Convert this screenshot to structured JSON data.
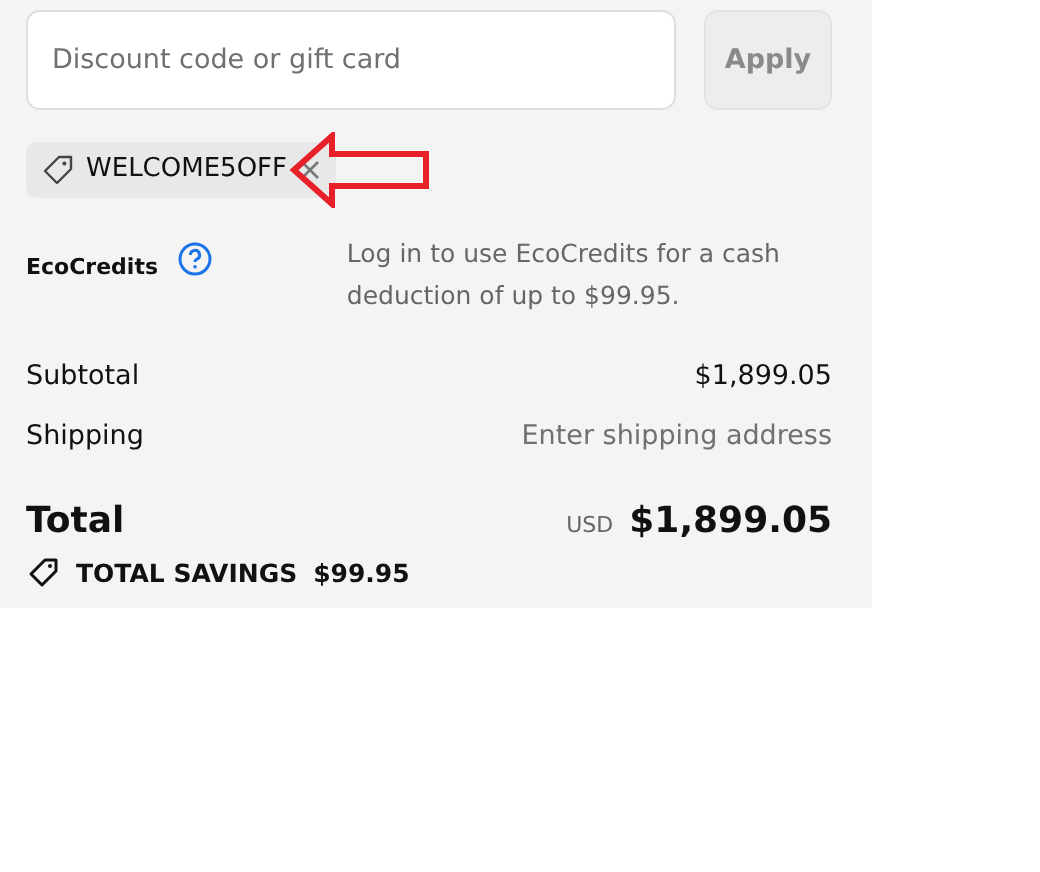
{
  "discount": {
    "placeholder": "Discount code or gift card",
    "button": "Apply",
    "disabled": true
  },
  "applied_codes": [
    {
      "code": "WELCOME5OFF"
    }
  ],
  "ecocredits": {
    "label": "EcoCredits",
    "message": "Log in to use EcoCredits for a cash deduction of up to $99.95."
  },
  "summary": [
    {
      "label": "Subtotal",
      "value": "$1,899.05",
      "muted": false
    },
    {
      "label": "Shipping",
      "value": "Enter shipping address",
      "muted": true
    }
  ],
  "total": {
    "label": "Total",
    "currency": "USD",
    "amount": "$1,899.05"
  },
  "savings": {
    "label": "TOTAL SAVINGS",
    "amount": "$99.95"
  }
}
